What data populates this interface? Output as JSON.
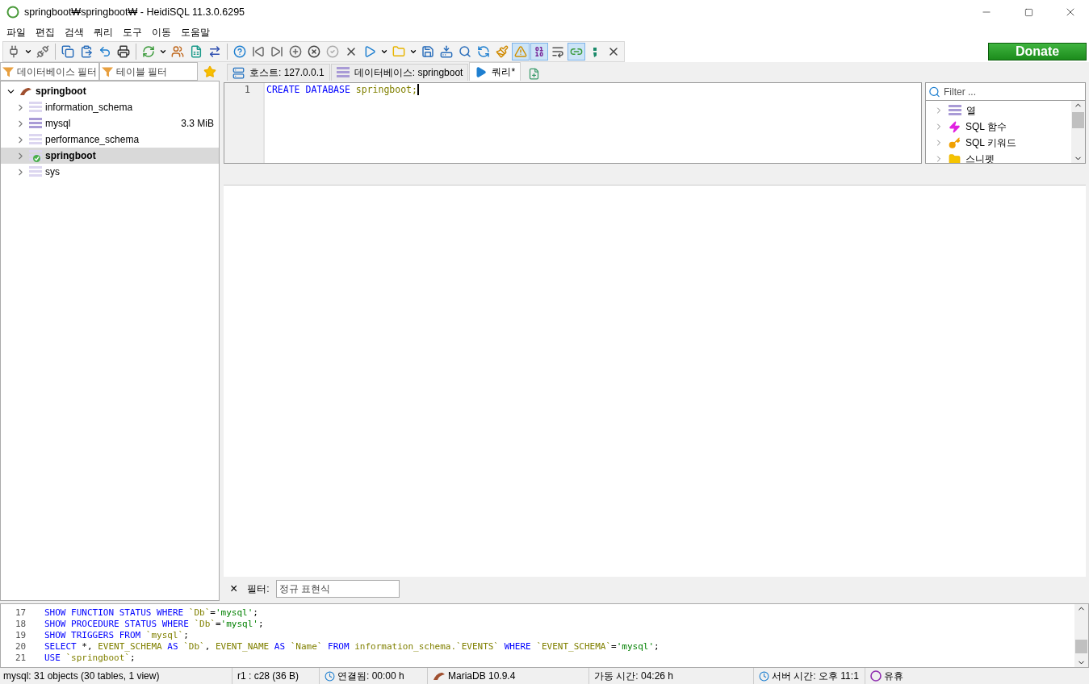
{
  "window": {
    "title": "springboot₩springboot₩ - HeidiSQL 11.3.0.6295"
  },
  "menu": [
    "파일",
    "편집",
    "검색",
    "쿼리",
    "도구",
    "이동",
    "도움말"
  ],
  "toolbar": [
    {
      "items": [
        {
          "kind": "plug"
        },
        {
          "kind": "dropdown"
        },
        {
          "kind": "unplug"
        }
      ]
    },
    {
      "items": [
        {
          "kind": "copy"
        },
        {
          "kind": "paste"
        },
        {
          "kind": "undo"
        },
        {
          "kind": "print"
        }
      ]
    },
    {
      "items": [
        {
          "kind": "refresh"
        },
        {
          "kind": "dropdown"
        },
        {
          "kind": "users"
        },
        {
          "kind": "csv"
        },
        {
          "kind": "transfer"
        }
      ]
    },
    {
      "items": [
        {
          "kind": "help"
        },
        {
          "kind": "first"
        },
        {
          "kind": "last"
        },
        {
          "kind": "add"
        },
        {
          "kind": "remove"
        },
        {
          "kind": "post"
        },
        {
          "kind": "cancel"
        },
        {
          "kind": "run"
        },
        {
          "kind": "dropdown"
        },
        {
          "kind": "folder"
        },
        {
          "kind": "dropdown"
        },
        {
          "kind": "save"
        },
        {
          "kind": "saveas"
        },
        {
          "kind": "find"
        },
        {
          "kind": "replace"
        },
        {
          "kind": "clean"
        },
        {
          "kind": "warning",
          "pressed": true
        },
        {
          "kind": "binary",
          "pressed": true
        },
        {
          "kind": "wrap",
          "pressed": false
        },
        {
          "kind": "link",
          "pressed": true
        },
        {
          "kind": "semicolon"
        },
        {
          "kind": "close"
        }
      ]
    }
  ],
  "donate": "Donate",
  "filters": {
    "database_placeholder": "데이터베이스 필터",
    "table_placeholder": "테이블 필터"
  },
  "tabs": [
    {
      "kind": "host",
      "label": "호스트: 127.0.0.1",
      "selected": false
    },
    {
      "kind": "database",
      "label": "데이터베이스: springboot",
      "selected": false
    },
    {
      "kind": "query",
      "label": "쿼리*",
      "selected": true
    }
  ],
  "tree": {
    "label": "springboot",
    "expanded": true,
    "children": [
      {
        "label": "information_schema",
        "selected": false,
        "active": false,
        "filled": false
      },
      {
        "label": "mysql",
        "size": "3.3 MiB",
        "selected": false,
        "active": false,
        "filled": true
      },
      {
        "label": "performance_schema",
        "selected": false,
        "active": false,
        "filled": false
      },
      {
        "label": "springboot",
        "selected": true,
        "active": true,
        "filled": false
      },
      {
        "label": "sys",
        "selected": false,
        "active": false,
        "filled": false
      }
    ]
  },
  "editor": {
    "lines": [
      {
        "number": "1",
        "tokens": [
          {
            "kind": "keyword",
            "text": "CREATE DATABASE "
          },
          {
            "kind": "ident",
            "text": "springboot;"
          }
        ]
      }
    ]
  },
  "helper": {
    "placeholder": "Filter ...",
    "items": [
      {
        "kind": "columns",
        "label": "열"
      },
      {
        "kind": "functions",
        "label": "SQL 함수"
      },
      {
        "kind": "keywords",
        "label": "SQL 키워드"
      },
      {
        "kind": "snippets",
        "label": "스니펫"
      }
    ]
  },
  "result_filter": {
    "close": "×",
    "label": "필터:",
    "placeholder": "정규 표현식"
  },
  "log": [
    {
      "number": "17",
      "tokens": [
        {
          "kind": "keyword",
          "text": "SHOW FUNCTION STATUS WHERE "
        },
        {
          "kind": "ident",
          "text": "`Db`"
        },
        {
          "kind": "plain",
          "text": "="
        },
        {
          "kind": "string",
          "text": "'mysql'"
        },
        {
          "kind": "plain",
          "text": ";"
        }
      ]
    },
    {
      "number": "18",
      "tokens": [
        {
          "kind": "keyword",
          "text": "SHOW PROCEDURE STATUS WHERE "
        },
        {
          "kind": "ident",
          "text": "`Db`"
        },
        {
          "kind": "plain",
          "text": "="
        },
        {
          "kind": "string",
          "text": "'mysql'"
        },
        {
          "kind": "plain",
          "text": ";"
        }
      ]
    },
    {
      "number": "19",
      "tokens": [
        {
          "kind": "keyword",
          "text": "SHOW TRIGGERS FROM "
        },
        {
          "kind": "ident",
          "text": "`mysql`"
        },
        {
          "kind": "plain",
          "text": ";"
        }
      ]
    },
    {
      "number": "20",
      "tokens": [
        {
          "kind": "keyword",
          "text": "SELECT"
        },
        {
          "kind": "plain",
          "text": " *, "
        },
        {
          "kind": "ident",
          "text": "EVENT_SCHEMA "
        },
        {
          "kind": "keyword",
          "text": "AS "
        },
        {
          "kind": "ident",
          "text": "`Db`"
        },
        {
          "kind": "plain",
          "text": ", "
        },
        {
          "kind": "ident",
          "text": "EVENT_NAME "
        },
        {
          "kind": "keyword",
          "text": "AS "
        },
        {
          "kind": "ident",
          "text": "`Name` "
        },
        {
          "kind": "keyword",
          "text": "FROM "
        },
        {
          "kind": "ident",
          "text": "information_schema.`EVENTS` "
        },
        {
          "kind": "keyword",
          "text": "WHERE "
        },
        {
          "kind": "ident",
          "text": "`EVENT_SCHEMA`"
        },
        {
          "kind": "plain",
          "text": "="
        },
        {
          "kind": "string",
          "text": "'mysql'"
        },
        {
          "kind": "plain",
          "text": ";"
        }
      ]
    },
    {
      "number": "21",
      "tokens": [
        {
          "kind": "keyword",
          "text": "USE "
        },
        {
          "kind": "ident",
          "text": "`springboot`"
        },
        {
          "kind": "plain",
          "text": ";"
        }
      ]
    }
  ],
  "status_bar": [
    {
      "kind": "text",
      "text": "mysql: 31 objects (30 tables, 1 view)"
    },
    {
      "kind": "text",
      "text": "r1 : c28 (36 B)"
    },
    {
      "kind": "clock",
      "text": "연결됨: 00:00 h"
    },
    {
      "kind": "server",
      "text": "MariaDB 10.9.4"
    },
    {
      "kind": "text",
      "text": "가동 시간: 04:26 h"
    },
    {
      "kind": "clock",
      "text": "서버 시간: 오후 11:1"
    },
    {
      "kind": "idle",
      "text": "유휴"
    }
  ]
}
